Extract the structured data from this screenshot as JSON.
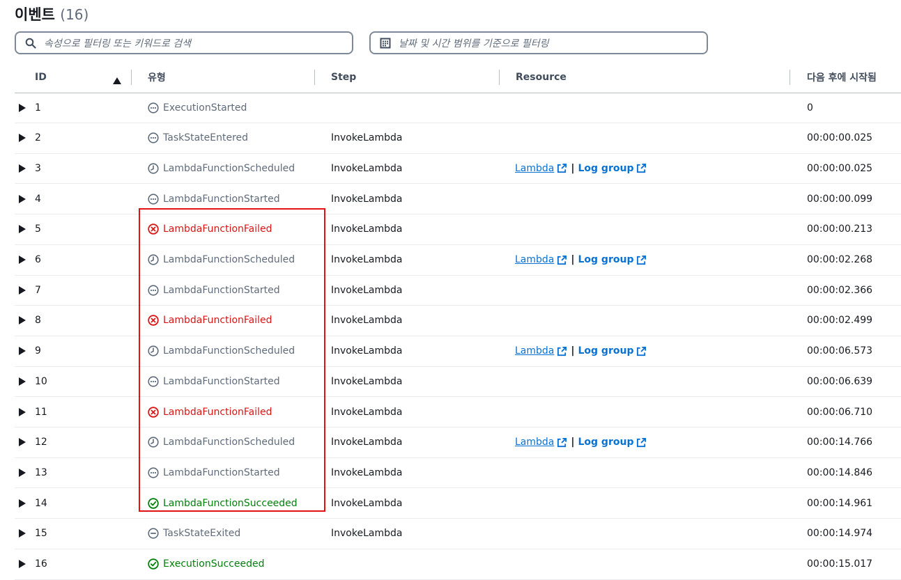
{
  "header": {
    "title": "이벤트",
    "count": "(16)"
  },
  "filters": {
    "search_placeholder": "속성으로 필터링 또는 키워드로 검색",
    "date_placeholder": "날짜 및 시간 범위를 기준으로 필터링"
  },
  "columns": {
    "id": "ID",
    "type": "유형",
    "step": "Step",
    "resource": "Resource",
    "time": "다음 후에 시작됨"
  },
  "resource_links": {
    "lambda": "Lambda",
    "separator": "|",
    "log_group": "Log group"
  },
  "colors": {
    "grey": "#5f6b7a",
    "red": "#d91515",
    "green": "#037f0c",
    "link": "#0972d3",
    "highlight": "#e01212"
  },
  "rows": [
    {
      "id": "1",
      "type": "ExecutionStarted",
      "status": "info",
      "step": "",
      "has_resource": false,
      "time": "0"
    },
    {
      "id": "2",
      "type": "TaskStateEntered",
      "status": "info",
      "step": "InvokeLambda",
      "has_resource": false,
      "time": "00:00:00.025"
    },
    {
      "id": "3",
      "type": "LambdaFunctionScheduled",
      "status": "scheduled",
      "step": "InvokeLambda",
      "has_resource": true,
      "time": "00:00:00.025"
    },
    {
      "id": "4",
      "type": "LambdaFunctionStarted",
      "status": "info",
      "step": "InvokeLambda",
      "has_resource": false,
      "time": "00:00:00.099"
    },
    {
      "id": "5",
      "type": "LambdaFunctionFailed",
      "status": "failed",
      "step": "InvokeLambda",
      "has_resource": false,
      "time": "00:00:00.213"
    },
    {
      "id": "6",
      "type": "LambdaFunctionScheduled",
      "status": "scheduled",
      "step": "InvokeLambda",
      "has_resource": true,
      "time": "00:00:02.268"
    },
    {
      "id": "7",
      "type": "LambdaFunctionStarted",
      "status": "info",
      "step": "InvokeLambda",
      "has_resource": false,
      "time": "00:00:02.366"
    },
    {
      "id": "8",
      "type": "LambdaFunctionFailed",
      "status": "failed",
      "step": "InvokeLambda",
      "has_resource": false,
      "time": "00:00:02.499"
    },
    {
      "id": "9",
      "type": "LambdaFunctionScheduled",
      "status": "scheduled",
      "step": "InvokeLambda",
      "has_resource": true,
      "time": "00:00:06.573"
    },
    {
      "id": "10",
      "type": "LambdaFunctionStarted",
      "status": "info",
      "step": "InvokeLambda",
      "has_resource": false,
      "time": "00:00:06.639"
    },
    {
      "id": "11",
      "type": "LambdaFunctionFailed",
      "status": "failed",
      "step": "InvokeLambda",
      "has_resource": false,
      "time": "00:00:06.710"
    },
    {
      "id": "12",
      "type": "LambdaFunctionScheduled",
      "status": "scheduled",
      "step": "InvokeLambda",
      "has_resource": true,
      "time": "00:00:14.766"
    },
    {
      "id": "13",
      "type": "LambdaFunctionStarted",
      "status": "info",
      "step": "InvokeLambda",
      "has_resource": false,
      "time": "00:00:14.846"
    },
    {
      "id": "14",
      "type": "LambdaFunctionSucceeded",
      "status": "success",
      "step": "InvokeLambda",
      "has_resource": false,
      "time": "00:00:14.961"
    },
    {
      "id": "15",
      "type": "TaskStateExited",
      "status": "exited",
      "step": "InvokeLambda",
      "has_resource": false,
      "time": "00:00:14.974"
    },
    {
      "id": "16",
      "type": "ExecutionSucceeded",
      "status": "success",
      "step": "",
      "has_resource": false,
      "time": "00:00:15.017"
    }
  ]
}
